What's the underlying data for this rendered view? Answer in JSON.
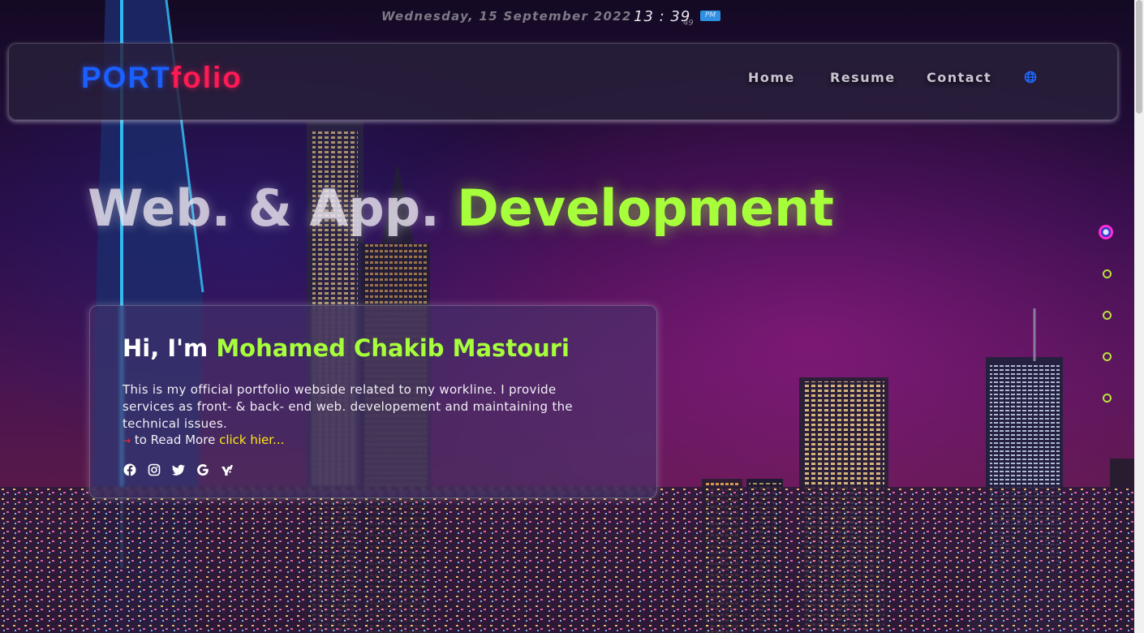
{
  "clock": {
    "date": "Wednesday, 15 September 2022",
    "time": "13 : 39",
    "seconds": "49",
    "ampm": "PM"
  },
  "nav": {
    "logo_part1": "PORT",
    "logo_part2": "folio",
    "links": [
      "Home",
      "Resume",
      "Contact"
    ],
    "language_icon": "globe-icon"
  },
  "hero": {
    "headline_part1": "Web. & App. ",
    "headline_part2": "Development"
  },
  "intro": {
    "greeting": "Hi, I'm ",
    "name": "Mohamed Chakib Mastouri",
    "description": "This is my official portfolio webside related to my workline. I provide services as front- & back- end web. developement and maintaining the technical issues.",
    "readmore_arrow": "→",
    "readmore_text": " to Read More ",
    "readmore_link": "click hier..."
  },
  "socials": [
    "facebook-icon",
    "instagram-icon",
    "twitter-icon",
    "google-icon",
    "yahoo-icon"
  ],
  "section_dots": {
    "count": 5,
    "active_index": 0
  },
  "colors": {
    "accent_green": "#a6ff3a",
    "logo_blue": "#1a5fff",
    "logo_red": "#ff1a55",
    "link_yellow": "#ffe81a",
    "active_dot": "#ff2dd4"
  }
}
